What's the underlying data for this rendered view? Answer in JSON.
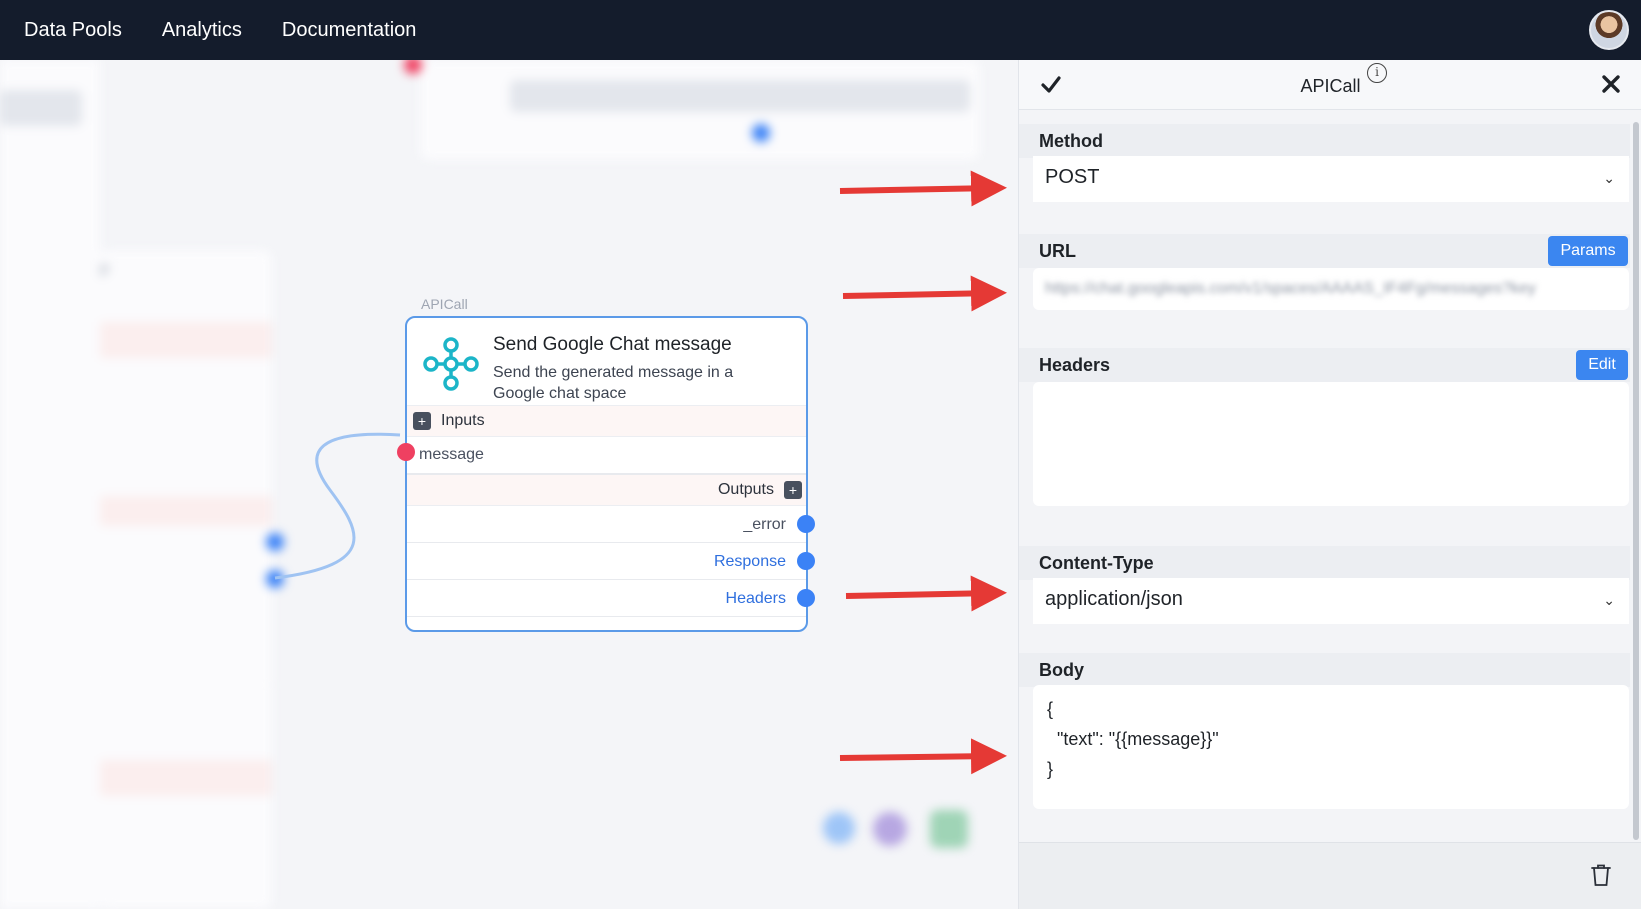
{
  "nav": {
    "links": [
      "Data Pools",
      "Analytics",
      "Documentation"
    ],
    "avatar_icon": "user-avatar"
  },
  "node": {
    "type_label": "APICall",
    "title": "Send Google Chat message",
    "description": "Send the generated message in a Google chat space",
    "inputs_label": "Inputs",
    "input_port": "message",
    "outputs_label": "Outputs",
    "outputs": [
      "_error",
      "Response",
      "Headers"
    ],
    "icon": "api-flower-icon"
  },
  "panel": {
    "title": "APICall",
    "method": {
      "label": "Method",
      "value": "POST"
    },
    "url": {
      "label": "URL",
      "value": "https://chat.googleapis.com/v1/spaces/AAAAS_IF4Fg/messages?key",
      "params_button": "Params"
    },
    "headers": {
      "label": "Headers",
      "edit_button": "Edit"
    },
    "content_type": {
      "label": "Content-Type",
      "value": "application/json"
    },
    "body": {
      "label": "Body",
      "lines": [
        "{",
        "  \"text\": \"{{message}}\"",
        "}"
      ]
    }
  },
  "colors": {
    "nav_bg": "#141c2c",
    "accent_blue": "#3b86f0",
    "port_red": "#ef4061",
    "arrow_red": "#e53935"
  }
}
